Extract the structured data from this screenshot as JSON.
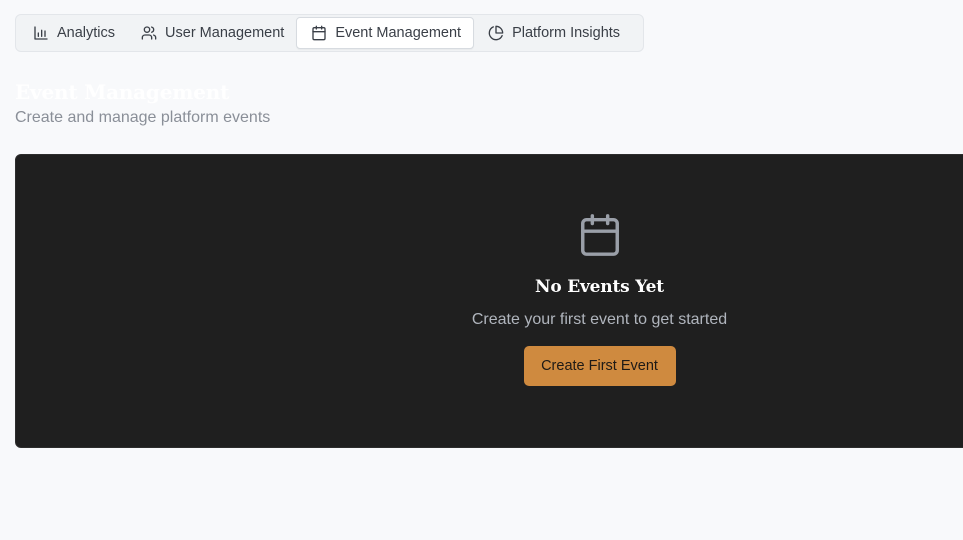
{
  "tabs": [
    {
      "label": "Analytics",
      "icon": "bar-chart-icon",
      "active": false
    },
    {
      "label": "User Management",
      "icon": "users-icon",
      "active": false
    },
    {
      "label": "Event Management",
      "icon": "calendar-icon",
      "active": true
    },
    {
      "label": "Platform Insights",
      "icon": "pie-chart-icon",
      "active": false
    }
  ],
  "header": {
    "title": "Event Management",
    "subtitle": "Create and manage platform events"
  },
  "empty_state": {
    "icon": "calendar-icon",
    "title": "No Events Yet",
    "description": "Create your first event to get started",
    "button_label": "Create First Event"
  },
  "colors": {
    "accent": "#cf8a3f",
    "panel_background": "#1f1f1f",
    "page_background": "#f8f9fb"
  }
}
